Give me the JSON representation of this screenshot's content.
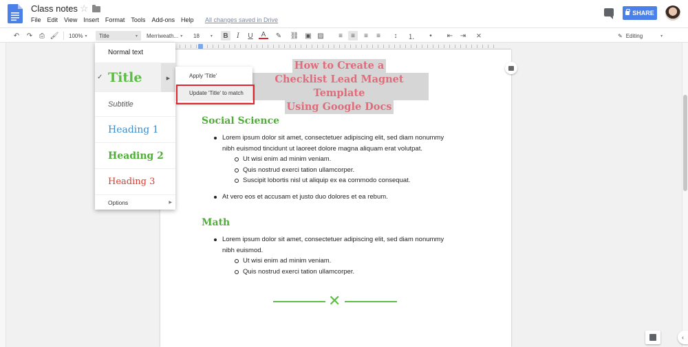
{
  "header": {
    "title": "Class notes",
    "menu": [
      "File",
      "Edit",
      "View",
      "Insert",
      "Format",
      "Tools",
      "Add-ons",
      "Help"
    ],
    "saved_status": "All changes saved in Drive",
    "share_label": "SHARE",
    "accent_color": "#4a80e8"
  },
  "toolbar": {
    "zoom": "100%",
    "style": "Title",
    "font": "Merriweath...",
    "font_size": "18",
    "bold": "B",
    "italic": "I",
    "underline": "U",
    "text_color": "A",
    "mode": "Editing"
  },
  "style_menu": {
    "normal": "Normal text",
    "title": "Title",
    "subtitle": "Subtitle",
    "h1": "Heading 1",
    "h2": "Heading 2",
    "h3": "Heading 3",
    "options": "Options"
  },
  "submenu": {
    "apply": "Apply 'Title'",
    "update": "Update 'Title' to match"
  },
  "document": {
    "title_lines": [
      "How to Create a",
      "Checklist Lead Magnet Template",
      "Using Google Docs"
    ],
    "section1": {
      "heading": "Social Science",
      "b1": "Lorem ipsum dolor sit amet, consectetuer adipiscing elit, sed diam nonummy",
      "b1_cont": "nibh euismod tincidunt ut laoreet dolore magna aliquam erat volutpat.",
      "sub": [
        "Ut wisi enim ad minim veniam.",
        "Quis nostrud exerci tation ullamcorper.",
        "Suscipit lobortis nisl ut aliquip ex ea commodo consequat."
      ],
      "b2": "At vero eos et accusam et justo duo dolores et ea rebum."
    },
    "section2": {
      "heading": "Math",
      "b1": "Lorem ipsum dolor sit amet, consectetuer adipiscing elit, sed diam nonummy",
      "b1_cont": "nibh euismod.",
      "sub": [
        "Ut wisi enim ad minim veniam.",
        "Quis nostrud exerci tation ullamcorper."
      ]
    },
    "title_color": "#e06b7a",
    "heading_color": "#4caf34"
  }
}
